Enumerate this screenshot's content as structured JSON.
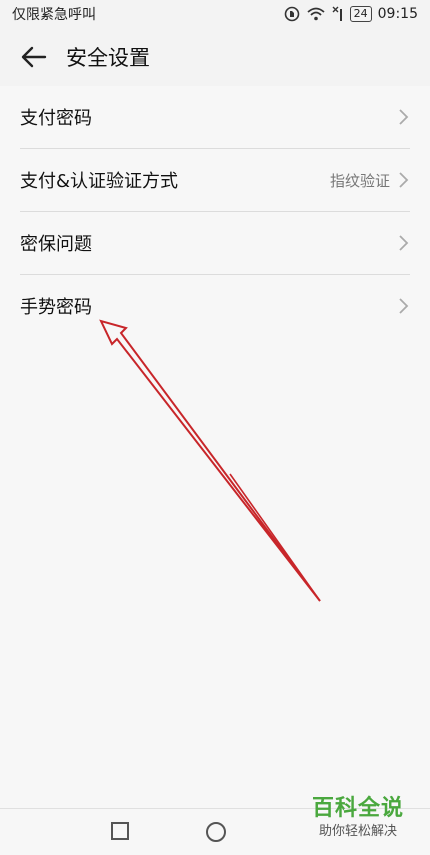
{
  "status": {
    "carrier": "仅限紧急呼叫",
    "battery": "24",
    "time": "09:15"
  },
  "header": {
    "title": "安全设置"
  },
  "settings": {
    "items": [
      {
        "label": "支付密码",
        "value": ""
      },
      {
        "label": "支付&认证验证方式",
        "value": "指纹验证"
      },
      {
        "label": "密保问题",
        "value": ""
      },
      {
        "label": "手势密码",
        "value": ""
      }
    ]
  },
  "watermark": {
    "title": "百科全说",
    "subtitle": "助你轻松解决"
  },
  "colors": {
    "arrow": "#c8262a",
    "watermark_green": "#4aa83e"
  },
  "icons": [
    "back-arrow-icon",
    "chevron-right-icon",
    "wifi-icon",
    "battery-icon",
    "recent-apps-icon",
    "home-icon"
  ]
}
